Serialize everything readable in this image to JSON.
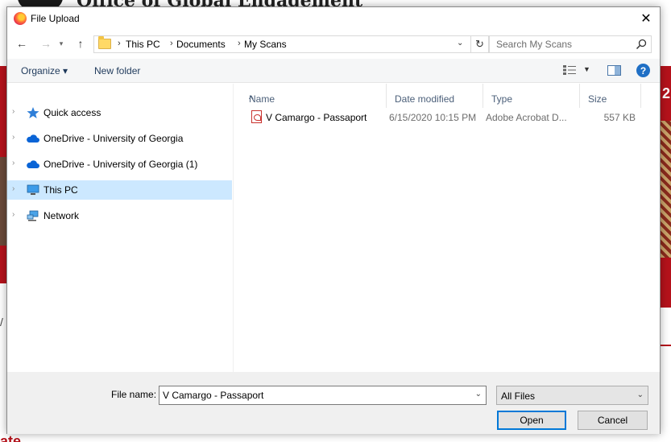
{
  "background": {
    "header_text": "Office of Global Engagement",
    "right_number": "2",
    "bottom_left_text": "ate",
    "slash": "/"
  },
  "dialog": {
    "title": "File Upload",
    "close_glyph": "✕"
  },
  "navbar": {
    "breadcrumb": [
      "This PC",
      "Documents",
      "My Scans"
    ],
    "search_placeholder": "Search My Scans"
  },
  "commandbar": {
    "organize_label": "Organize ▾",
    "new_folder_label": "New folder",
    "help_glyph": "?"
  },
  "nav_pane": {
    "items": [
      {
        "label": "Quick access",
        "icon": "star-icon"
      },
      {
        "label": "OneDrive - University of Georgia",
        "icon": "cloud-icon"
      },
      {
        "label": "OneDrive - University of Georgia (1)",
        "icon": "cloud-icon"
      },
      {
        "label": "This PC",
        "icon": "computer-icon",
        "selected": true
      },
      {
        "label": "Network",
        "icon": "network-icon"
      }
    ]
  },
  "file_list": {
    "columns": [
      "Name",
      "Date modified",
      "Type",
      "Size"
    ],
    "rows": [
      {
        "name": "V Camargo - Passaport",
        "date": "6/15/2020 10:15 PM",
        "type": "Adobe Acrobat D...",
        "size": "557 KB",
        "icon": "pdf-icon"
      }
    ]
  },
  "bottom": {
    "file_name_label": "File name:",
    "file_name_value": "V Camargo - Passaport",
    "filter_value": "All Files",
    "open_label": "Open",
    "cancel_label": "Cancel"
  },
  "colors": {
    "accent": "#0078d7",
    "selection": "#cce8ff",
    "brand_red": "#b5121b"
  }
}
